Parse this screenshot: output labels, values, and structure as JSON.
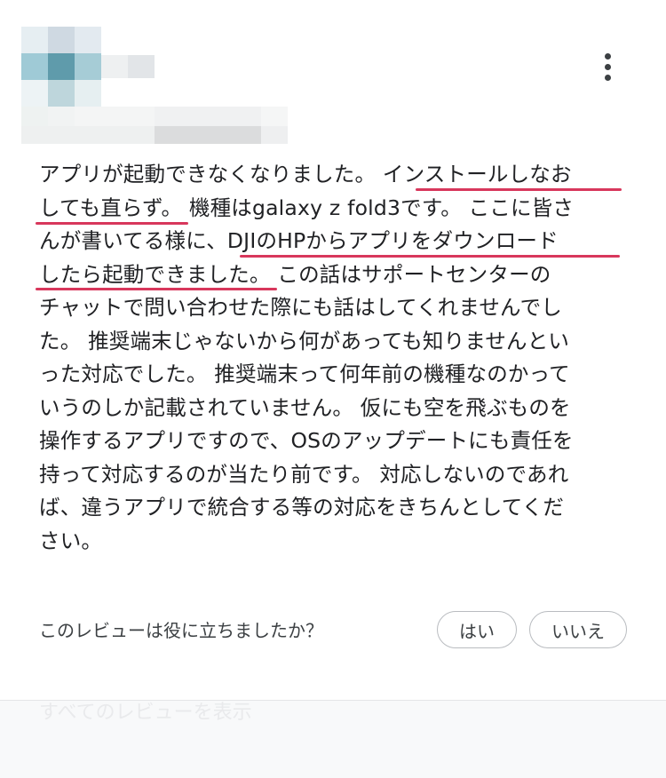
{
  "review": {
    "more_menu_icon": "more-vert-icon",
    "lines": [
      "アプリが起動できなくなりました。 インストールしなお",
      "しても直らず。 機種はgalaxy z fold3です。 ここに皆さ",
      "んが書いてる様に、DJIのHPからアプリをダウンロード",
      "したら起動できました。 この話はサポートセンターの",
      "チャットで問い合わせた際にも話はしてくれませんでし",
      "た。 推奨端末じゃないから何があっても知りませんとい",
      "った対応でした。 推奨端末って何年前の機種なのかって",
      "いうのしか記載されていません。 仮にも空を飛ぶものを",
      "操作するアプリですので、OSのアップデートにも責任を",
      "持って対応するのが当たり前です。 対応しないのであれ",
      "ば、違うアプリで統合する等の対応をきちんとしてくだ",
      "さい。"
    ],
    "highlight_color": "#d8375c"
  },
  "feedback": {
    "question": "このレビューは役に立ちましたか？",
    "yes_label": "はい",
    "no_label": "いいえ"
  },
  "footer": {
    "show_all_label": "すべてのレビューを表示"
  }
}
